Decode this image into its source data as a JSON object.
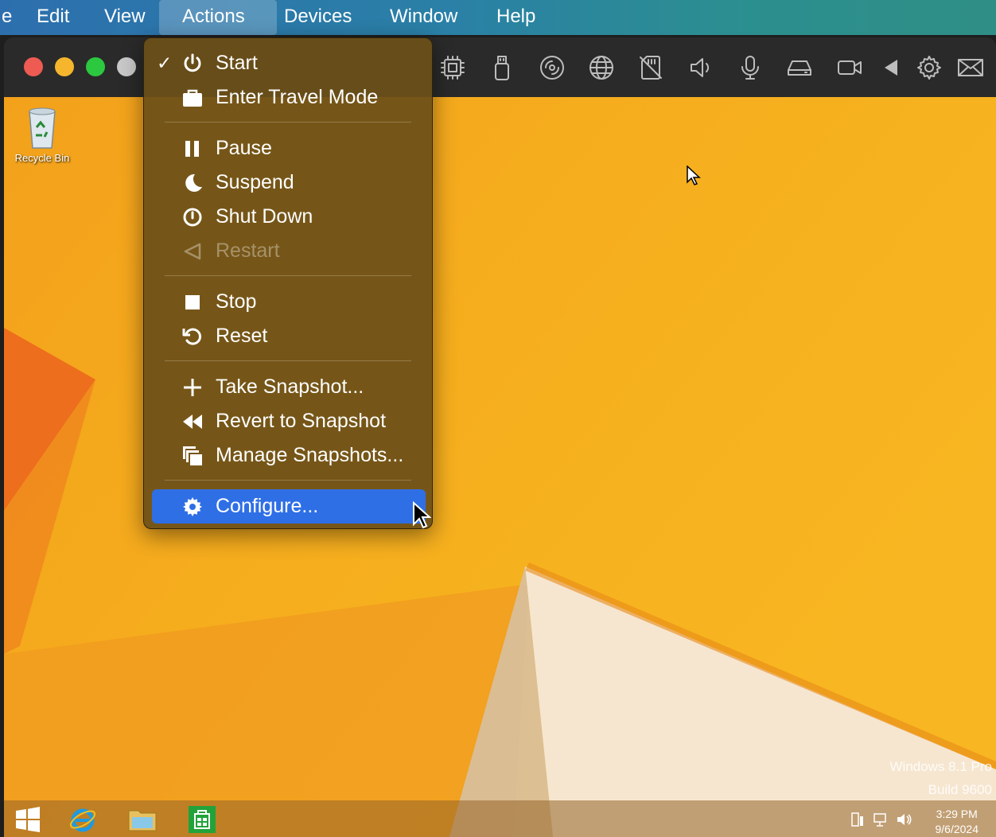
{
  "menubar": {
    "items": [
      {
        "label": "e"
      },
      {
        "label": "Edit"
      },
      {
        "label": "View"
      },
      {
        "label": "Actions"
      },
      {
        "label": "Devices"
      },
      {
        "label": "Window"
      },
      {
        "label": "Help"
      }
    ],
    "active": "Actions"
  },
  "toolbar": {
    "icons": [
      "cpu-icon",
      "usb-icon",
      "disc-icon",
      "globe-icon",
      "no-sd-card-icon",
      "speaker-icon",
      "microphone-icon",
      "hard-drive-icon",
      "camera-icon",
      "back-arrow-icon",
      "gear-icon",
      "mail-icon"
    ]
  },
  "actions_menu": {
    "groups": [
      [
        {
          "label": "Start",
          "icon": "power-icon",
          "checked": true
        },
        {
          "label": "Enter Travel Mode",
          "icon": "briefcase-icon"
        }
      ],
      [
        {
          "label": "Pause",
          "icon": "pause-icon"
        },
        {
          "label": "Suspend",
          "icon": "moon-icon"
        },
        {
          "label": "Shut Down",
          "icon": "shutdown-icon"
        },
        {
          "label": "Restart",
          "icon": "restart-icon",
          "disabled": true
        }
      ],
      [
        {
          "label": "Stop",
          "icon": "stop-icon"
        },
        {
          "label": "Reset",
          "icon": "reset-icon"
        }
      ],
      [
        {
          "label": "Take Snapshot...",
          "icon": "plus-icon"
        },
        {
          "label": "Revert to Snapshot",
          "icon": "rewind-icon"
        },
        {
          "label": "Manage Snapshots...",
          "icon": "snapshots-icon"
        }
      ],
      [
        {
          "label": "Configure...",
          "icon": "gear-icon",
          "highlighted": true
        }
      ]
    ]
  },
  "desktop": {
    "recycle_bin_label": "Recycle Bin",
    "watermark_line1": "Windows 8.1 Pro",
    "watermark_line2": "Build 9600"
  },
  "taskbar": {
    "time": "3:29 PM",
    "date": "9/6/2024"
  },
  "colors": {
    "menu_highlight": "#2f6fe6",
    "desktop_orange": "#f4a91c",
    "traffic_red": "#ee5b52",
    "traffic_yellow": "#f5b52d",
    "traffic_green": "#2bc840"
  }
}
